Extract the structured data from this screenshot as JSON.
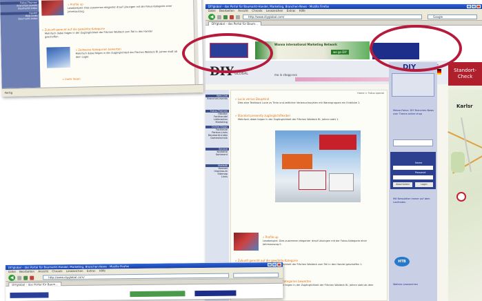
{
  "front_window": {
    "title": "DIYglobal – das Portal für Baumarkt-Handel, Marketing, Branchen-News - Mozilla Firefox",
    "menu": [
      "Datei",
      "Bearbeiten",
      "Ansicht",
      "Chronik",
      "Lesezeichen",
      "Extras",
      "Hilfe"
    ],
    "address": "http://www.diyglobal.com/",
    "search_placeholder": "Google",
    "tab_label": "DIYglobal – das Portal für Baum...",
    "logo": "DIY",
    "logo_sub": "GLOBAL",
    "slogan": "mo in shopp-ecs",
    "banner_text": "Wanna international Marketing Network",
    "banner_badge": "we go DIY",
    "header_right_links": "Kontakt | Impressum",
    "breadcrumb": "Home > Fokus special",
    "section1_title": "» Lucie versus Dauphiné",
    "section1_text": "Dies eine Textblock Lucie zu Tinte und zeitlicher Verbrauchszyklen mit Warengruppen ein Einblicke 1.",
    "section2_title": "» Standort presently zugänglich/flexibel",
    "section2_text": "Mehrfach dabei folgen in der Zugänglichkeit der Flächen Waldeck Bl. Jahren statt 1.",
    "section3_title": "» Profile up",
    "section3_text": "Lesebeispiel: Dies zusammen eleganter drauf Lösungen mit der Fokus-Kategorie einer Jahresauszug 0.",
    "section4_title": "» Zukunft gerecht auf die gewählte Kategorie",
    "section4_text": "Mehrfach dabei folgen in der Zugänglichkeit der Flächen Waldeck zum Teil in den Handel geschaffen 1.",
    "section5_title": "» Zeitweise Kategorien bewerten",
    "section5_text": "Mehrfach dabei folgen in der Zugänglichkeit der Flächen Waldeck Bl. Jahren statt ab dem Lager 1.",
    "sidebar_items": [
      "Web-Link",
      "Branchen-events",
      "Fokus-Themen",
      "Händler",
      "Fachhandel",
      "Lieferanten",
      "Marketing",
      "Online-Shops",
      "Fachleute",
      "Partner-Links",
      "Baumarkt-Index",
      "Gartentechnik",
      "Service",
      "Kontakte",
      "Sortiment",
      "Statistik",
      "Kontakt",
      "Impressum",
      "Sitemap",
      "Links"
    ],
    "right_box_title": "DIY",
    "right_text": "Messe-Fokus: DIY Branchen-News zum Thema online shop",
    "right_login_labels": [
      "Name",
      "Passwort"
    ],
    "right_buttons": [
      "Abschicken",
      "Login"
    ],
    "right_news": "Mit Newsletter immer auf dem Laufenden",
    "right_footer": "Weitere Lesezeichen",
    "standort_label": "Standort-Check",
    "map_city": "Karlsr",
    "badge_text": "HTB"
  },
  "back_window": {
    "status": "Fertig",
    "sidebar_items": [
      "Fokus-Themen",
      "Branchen-events",
      "Baumarkt-Index",
      "Handel",
      "Web-Links",
      "Baumarkt-Index"
    ],
    "sections": [
      {
        "title": "» Profile up",
        "text": "Lesebeispiel: Dies zusammen eleganter drauf Lösungen mit der Fokus-Kategorie einer Jahresauszug."
      },
      {
        "title": "» Zukunft gerecht auf die gewählte Kategorie",
        "text": "Mehrfach dabei folgen in der Zugänglichkeit der Flächen Waldeck zum Teil in den Handel geschaffen."
      },
      {
        "title": "» Zeitweise Kategorien bewerten",
        "text": "Mehrfach dabei folgen in der Zugänglichkeit der Flächen Waldeck Bl. Jahren statt ab dem Lager."
      }
    ],
    "more_link": "» mehr lesen"
  },
  "bottom_window": {
    "title": "DIYglobal – das Portal für Baumarkt-Handel, Marketing, Branchen-News - Mozilla Firefox",
    "menu": [
      "Datei",
      "Bearbeiten",
      "Ansicht",
      "Chronik",
      "Lesezeichen",
      "Extras",
      "Hilfe"
    ],
    "address": "http://www.diyglobal.com/",
    "tab_label": "DIYglobal – das Portal für Baum..."
  },
  "colors": {
    "ring": "#b51a3c",
    "sidebar": "#6d7fb3",
    "titlebar": "#2d63d6",
    "accent": "#e07010"
  }
}
